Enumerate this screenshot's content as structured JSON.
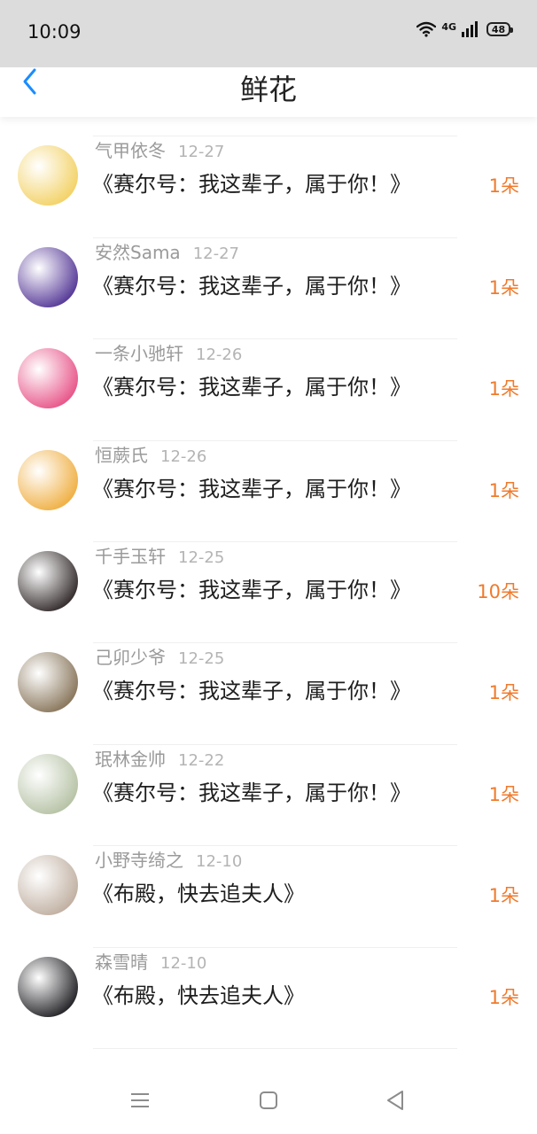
{
  "status_bar": {
    "time": "10:09",
    "network": "4G",
    "battery": "48",
    "icons": [
      "wifi-icon",
      "signal-icon",
      "battery-icon"
    ]
  },
  "header": {
    "title": "鲜花",
    "back_icon": "chevron-left-icon",
    "accent_color": "#1a8cff"
  },
  "rows": [
    {
      "user": "",
      "date": "",
      "book": "《赛尔号：我这辈子，属于你！》",
      "count": "10朵",
      "avatar_color": "#7a6a60"
    },
    {
      "user": "气甲依冬",
      "date": "12-27",
      "book": "《赛尔号：我这辈子，属于你！》",
      "count": "1朵",
      "avatar_color": "#f3d36b"
    },
    {
      "user": "安然Sama",
      "date": "12-27",
      "book": "《赛尔号：我这辈子，属于你！》",
      "count": "1朵",
      "avatar_color": "#5b3f9a"
    },
    {
      "user": "一条小驰轩",
      "date": "12-26",
      "book": "《赛尔号：我这辈子，属于你！》",
      "count": "1朵",
      "avatar_color": "#e85a8c"
    },
    {
      "user": "恒蕨氏",
      "date": "12-26",
      "book": "《赛尔号：我这辈子，属于你！》",
      "count": "1朵",
      "avatar_color": "#f0b24a"
    },
    {
      "user": "千手玉轩",
      "date": "12-25",
      "book": "《赛尔号：我这辈子，属于你！》",
      "count": "10朵",
      "avatar_color": "#3a3232"
    },
    {
      "user": "己卯少爷",
      "date": "12-25",
      "book": "《赛尔号：我这辈子，属于你！》",
      "count": "1朵",
      "avatar_color": "#8c7a60"
    },
    {
      "user": "珉林金帅",
      "date": "12-22",
      "book": "《赛尔号：我这辈子，属于你！》",
      "count": "1朵",
      "avatar_color": "#b8c4a8"
    },
    {
      "user": "小野寺绮之",
      "date": "12-10",
      "book": "《布殿，快去追夫人》",
      "count": "1朵",
      "avatar_color": "#c2b2a4"
    },
    {
      "user": "森雪晴",
      "date": "12-10",
      "book": "《布殿，快去追夫人》",
      "count": "1朵",
      "avatar_color": "#2a2a2e"
    }
  ],
  "nav_bar": {
    "icons": [
      "menu-icon",
      "home-square-icon",
      "back-triangle-icon"
    ]
  },
  "colors": {
    "count": "#f07a2c",
    "username": "#9a9a9a",
    "date": "#b4b4b4",
    "status_bar_bg": "#dcdcdc"
  }
}
